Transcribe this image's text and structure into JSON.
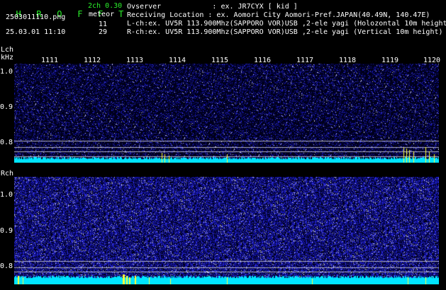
{
  "app": {
    "title_letters": [
      "H",
      "R",
      "O",
      "F",
      "F",
      "T"
    ],
    "mode": "2ch 0.30",
    "meteor_label": "meteor",
    "filename": "2503011110.png",
    "datetime": "25.03.01 11:10",
    "l_count": "11",
    "r_count": "29"
  },
  "info": {
    "observer": "Ovserver            : ex. JR7CYX [ kid ]",
    "location": "Receiving Location : ex. Aomori City Aomori-Pref.JAPAN(40.49N, 140.47E)",
    "lch_desc": "L-ch:ex. UV5R 113.900Mhz(SAPPORO VOR)USB ,2-ele yagi (Holozontal 10m height)",
    "rch_desc": "R-ch:ex. UV5R 113.900Mhz(SAPPORO VOR)USB ,2-ele yagi (Vertical 10m height)"
  },
  "lch": {
    "label": "Lch",
    "unit": "kHz"
  },
  "rch": {
    "label": "Rch"
  },
  "x_ticks": [
    "1111",
    "1112",
    "1113",
    "1114",
    "1115",
    "1116",
    "1117",
    "1118",
    "1119",
    "1120"
  ],
  "y_ticks": [
    "1.0",
    "0.9",
    "0.8"
  ],
  "colors": {
    "accent_green": "#2bf02b",
    "noise_blue": "#1a1aa0",
    "cyan_floor": "#00e5ff",
    "yellow_marker": "#ffff33"
  }
}
